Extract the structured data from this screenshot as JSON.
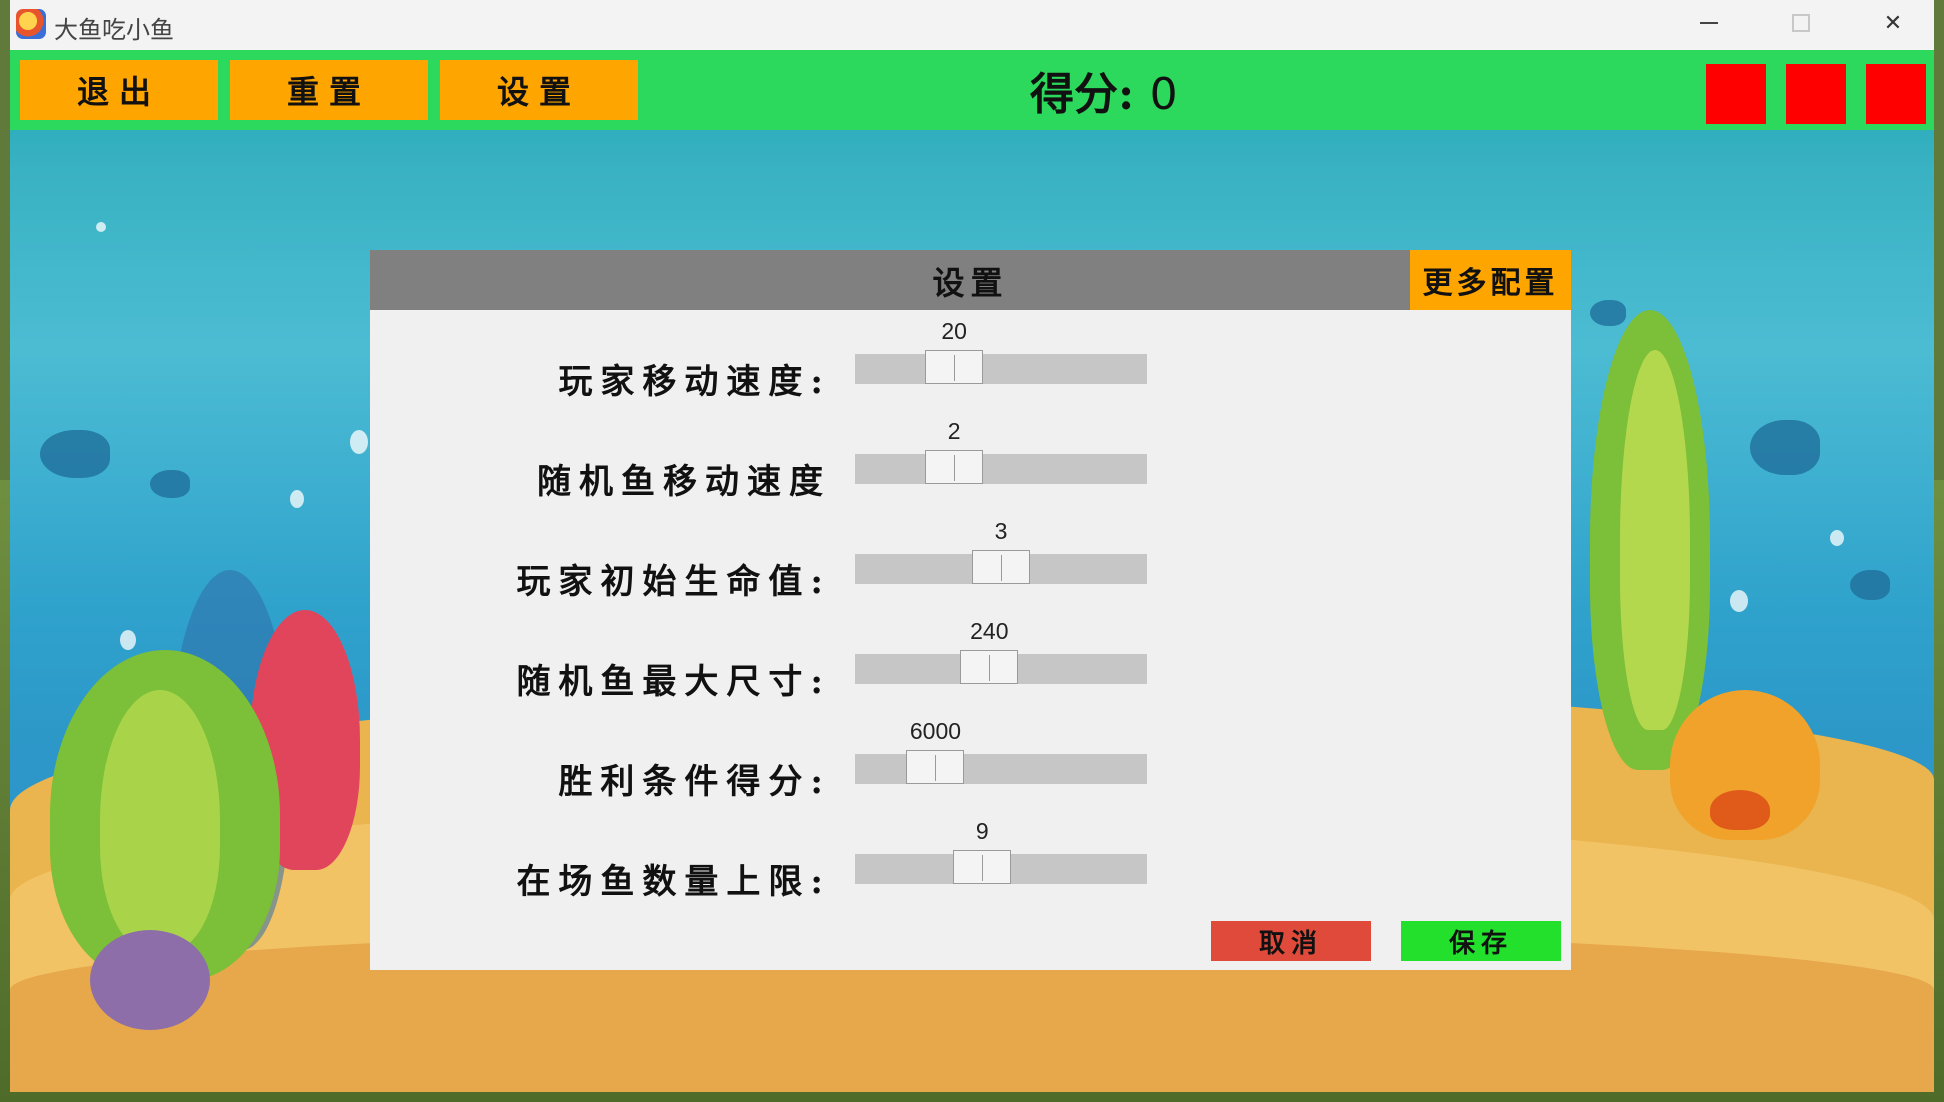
{
  "window": {
    "title": "大鱼吃小鱼"
  },
  "toolbar": {
    "exit_label": "退出",
    "reset_label": "重置",
    "settings_label": "设置",
    "score_label": "得分:",
    "score_value": "0",
    "lives": 3
  },
  "dialog": {
    "title": "设置",
    "more_label": "更多配置",
    "rows": [
      {
        "label": "玩家移动速度:",
        "value": "20",
        "position": 0.3
      },
      {
        "label": "随机鱼移动速度",
        "value": "2",
        "position": 0.3
      },
      {
        "label": "玩家初始生命值:",
        "value": "3",
        "position": 0.5
      },
      {
        "label": "随机鱼最大尺寸:",
        "value": "240",
        "position": 0.45
      },
      {
        "label": "胜利条件得分:",
        "value": "6000",
        "position": 0.22
      },
      {
        "label": "在场鱼数量上限:",
        "value": "9",
        "position": 0.42
      }
    ],
    "cancel_label": "取消",
    "save_label": "保存"
  },
  "colors": {
    "toolbar_bg": "#2dd95d",
    "button_orange": "#ffa500",
    "life_red": "#ff0000",
    "cancel_red": "#e04a3a",
    "save_green": "#22e02c",
    "dialog_header": "#808080"
  }
}
